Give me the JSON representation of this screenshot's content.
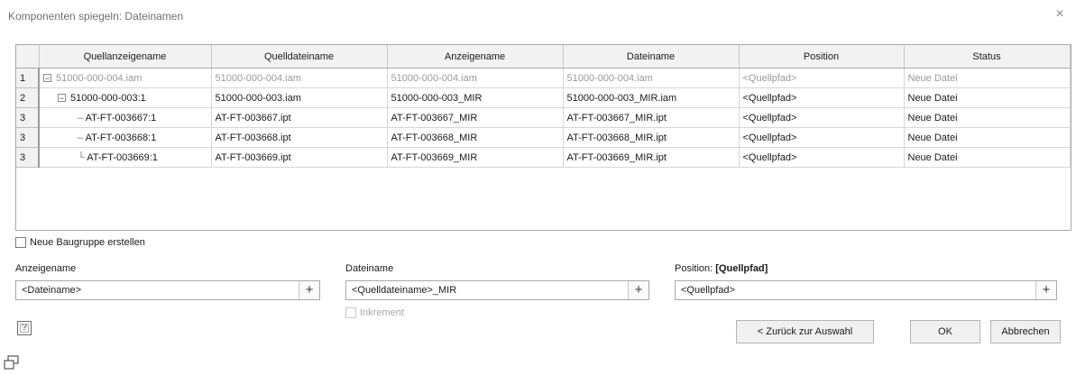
{
  "window": {
    "title": "Komponenten spiegeln: Dateinamen",
    "close_glyph": "×"
  },
  "grid": {
    "columns": [
      "Quellanzeigename",
      "Quelldateiname",
      "Anzeigename",
      "Dateiname",
      "Position",
      "Status"
    ],
    "rows": [
      {
        "num": "1",
        "name": "51000-000-004.iam",
        "source_file": "51000-000-004.iam",
        "display_name": "51000-000-004.iam",
        "file_name": "51000-000-004.iam",
        "position": "<Quellpfad>",
        "status": "Neue Datei"
      },
      {
        "num": "2",
        "name": "51000-000-003:1",
        "source_file": "51000-000-003.iam",
        "display_name": "51000-000-003_MIR",
        "file_name": "51000-000-003_MIR.iam",
        "position": "<Quellpfad>",
        "status": "Neue Datei"
      },
      {
        "num": "3",
        "name": "AT-FT-003667:1",
        "source_file": "AT-FT-003667.ipt",
        "display_name": "AT-FT-003667_MIR",
        "file_name": "AT-FT-003667_MIR.ipt",
        "position": "<Quellpfad>",
        "status": "Neue Datei"
      },
      {
        "num": "3",
        "name": "AT-FT-003668:1",
        "source_file": "AT-FT-003668.ipt",
        "display_name": "AT-FT-003668_MIR",
        "file_name": "AT-FT-003668_MIR.ipt",
        "position": "<Quellpfad>",
        "status": "Neue Datei"
      },
      {
        "num": "3",
        "name": "AT-FT-003669:1",
        "source_file": "AT-FT-003669.ipt",
        "display_name": "AT-FT-003669_MIR",
        "file_name": "AT-FT-003669_MIR.ipt",
        "position": "<Quellpfad>",
        "status": "Neue Datei"
      }
    ]
  },
  "options": {
    "new_assembly_label": "Neue Baugruppe erstellen",
    "new_assembly_checked": false
  },
  "fields": {
    "display_name": {
      "label": "Anzeigename",
      "value": "<Dateiname>",
      "plus": "+"
    },
    "file_name": {
      "label": "Dateiname",
      "value": "<Quelldateiname>_MIR",
      "plus": "+",
      "increment_label": "Inkrement"
    },
    "position": {
      "label_prefix": "Position:",
      "label_value": "[Quellpfad]",
      "value": "<Quellpfad>",
      "plus": "+"
    }
  },
  "help": {
    "glyph": "?"
  },
  "buttons": {
    "back": "< Zurück zur Auswahl",
    "ok": "OK",
    "cancel": "Abbrechen"
  },
  "icons": {
    "help": "help-icon",
    "close": "close-icon",
    "expand": "expand-icon",
    "restore": "window-restore-icon"
  }
}
